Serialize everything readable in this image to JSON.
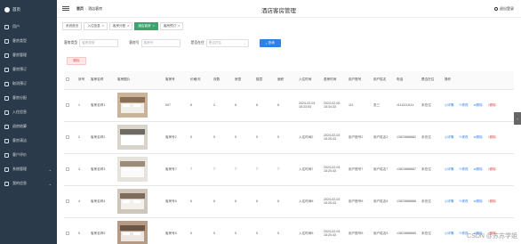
{
  "sidebar": {
    "brand": "首页",
    "items": [
      {
        "label": "用户"
      },
      {
        "label": "客房类型"
      },
      {
        "label": "客房管理"
      },
      {
        "label": "客房预订"
      },
      {
        "label": "取消预订"
      },
      {
        "label": "客房分配"
      },
      {
        "label": "入住信息"
      },
      {
        "label": "退房结算"
      },
      {
        "label": "客房清洁"
      },
      {
        "label": "客户评价"
      },
      {
        "label": "系统管理"
      },
      {
        "label": "我的信息"
      }
    ]
  },
  "header": {
    "breadcrumb_home": "首页",
    "breadcrumb_current": "酒店客房",
    "title": "酒店客房管理",
    "logout": "退出登录"
  },
  "tabs": [
    {
      "label": "系统首页"
    },
    {
      "label": "入住信息"
    },
    {
      "label": "客房分配"
    },
    {
      "label": "酒店客房"
    },
    {
      "label": "客房预订"
    }
  ],
  "filters": {
    "type_label": "客房类型",
    "type_placeholder": "客房类型",
    "room_label": "客房号",
    "room_placeholder": "客房号",
    "status_label": "是否在住",
    "status_placeholder": "是否在住",
    "search_label": "查询"
  },
  "delete_label": "删除",
  "table": {
    "headers": [
      "序号",
      "客房名称",
      "客房图片",
      "客房号",
      "价格/天",
      "床数",
      "房型",
      "楼层",
      "面积",
      "入住时间",
      "退房时间",
      "用户账号",
      "用户姓名",
      "电话",
      "是否在住",
      "操作"
    ],
    "rows": [
      {
        "idx": "1",
        "name": "客房名称1",
        "room": "007",
        "price": "8",
        "beds": "2",
        "type": "8",
        "floor": "8",
        "area": "8",
        "checkin": "2024-02-03 16:33:53",
        "checkout": "2024-02-05 15:34:33",
        "account": "111",
        "user": "张三",
        "phone": "11111111111",
        "status": "未在住"
      },
      {
        "idx": "2",
        "name": "客房名称2",
        "room": "客房号2",
        "price": "5",
        "beds": "5",
        "type": "5",
        "floor": "5",
        "area": "5",
        "checkin": "入住时间2",
        "checkout": "2024-02-03 15:20:43",
        "account": "用户账号2",
        "user": "用户姓名2",
        "phone": "13823888882",
        "status": "未在住"
      },
      {
        "idx": "3",
        "name": "客房名称3",
        "room": "客房号7",
        "price": "7",
        "beds": "7",
        "type": "7",
        "floor": "7",
        "area": "7",
        "checkin": "入住时间7",
        "checkout": "2024-02-03 15:20:43",
        "account": "用户账号7",
        "user": "用户姓名7",
        "phone": "13823888887",
        "status": "未在住"
      },
      {
        "idx": "4",
        "name": "客房名称4",
        "room": "客房号6",
        "price": "6",
        "beds": "6",
        "type": "6",
        "floor": "6",
        "area": "6",
        "checkin": "入住时间6",
        "checkout": "2024-02-03 15:20:43",
        "account": "用户账号6",
        "user": "用户姓名6",
        "phone": "13823888886",
        "status": "未在住"
      },
      {
        "idx": "5",
        "name": "客房名称5",
        "room": "客房号5",
        "price": "5",
        "beds": "5",
        "type": "5",
        "floor": "5",
        "area": "5",
        "checkin": "入住时间5",
        "checkout": "2024-02-03 15:20:43",
        "account": "用户账号5",
        "user": "用户姓名5",
        "phone": "13823888885",
        "status": "未在住"
      }
    ],
    "actions": {
      "detail": "详情",
      "edit": "修改",
      "delete": "删除"
    }
  },
  "watermark": "CSDN @苏苏学姐",
  "colors": {
    "sidebar": "#2b3a4a",
    "accent": "#3aa66d",
    "primary": "#2f7fe8",
    "danger": "#e04d4d"
  }
}
